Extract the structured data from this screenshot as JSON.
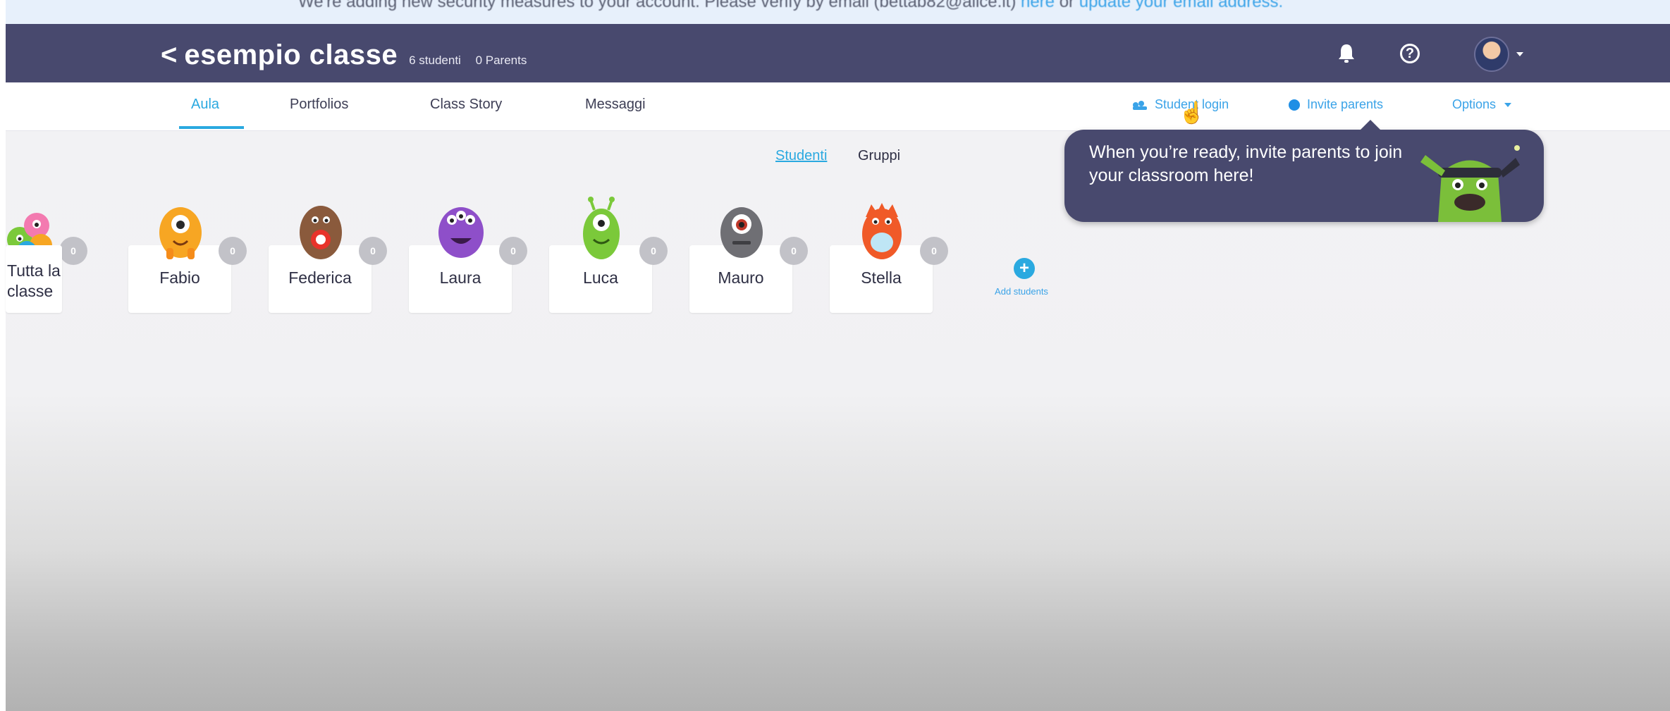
{
  "banner": {
    "text": "We're adding new security measures to your account. Please verify by email (bettab82@alice.it)",
    "link_here": "here",
    "or": "or",
    "link_update": "update your email address."
  },
  "header": {
    "back_icon": "chevron-left-icon",
    "class_name": "esempio classe",
    "students_count": "6 studenti",
    "parents_count": "0 Parents",
    "notifications_icon": "bell-icon",
    "help_icon": "help-icon",
    "help_glyph": "?"
  },
  "tabs": [
    {
      "label": "Aula",
      "active": true
    },
    {
      "label": "Portfolios"
    },
    {
      "label": "Class Story"
    },
    {
      "label": "Messaggi"
    }
  ],
  "actions": {
    "student_login": "Student login",
    "invite_parents": "Invite parents",
    "options": "Options"
  },
  "view_toggle": {
    "studenti": "Studenti",
    "gruppi": "Gruppi",
    "selected": "Studenti"
  },
  "tooltip": {
    "text": "When you’re ready, invite parents to join your classroom here!"
  },
  "students": [
    {
      "name": "Tutta la classe",
      "points": "0",
      "color": "#f37ab0"
    },
    {
      "name": "Fabio",
      "points": "0",
      "color": "#f7a623"
    },
    {
      "name": "Federica",
      "points": "0",
      "color": "#8a5a3c"
    },
    {
      "name": "Laura",
      "points": "0",
      "color": "#8e4fc9"
    },
    {
      "name": "Luca",
      "points": "0",
      "color": "#7bc93a"
    },
    {
      "name": "Mauro",
      "points": "0",
      "color": "#6f6f74"
    },
    {
      "name": "Stella",
      "points": "0",
      "color": "#f05a28"
    }
  ],
  "add_students": {
    "label": "Add students",
    "glyph": "+"
  },
  "colors": {
    "header_bg": "#48496e",
    "accent": "#2aa9e0",
    "points_badge": "#c2c2c8"
  }
}
